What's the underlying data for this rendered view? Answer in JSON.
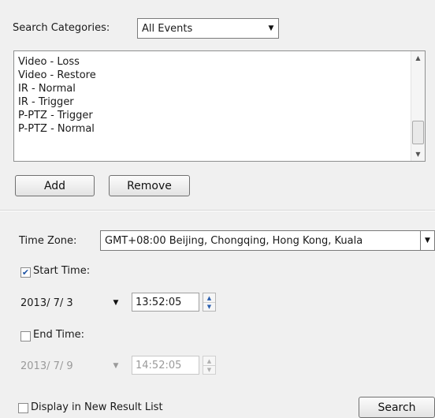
{
  "search_categories": {
    "label": "Search Categories:",
    "selected": "All Events",
    "options_visible": [
      "All Events"
    ]
  },
  "event_list": {
    "items": [
      "Video - Loss",
      "Video - Restore",
      "IR - Normal",
      "IR - Trigger",
      "P-PTZ - Trigger",
      "P-PTZ - Normal"
    ]
  },
  "buttons": {
    "add": "Add",
    "remove": "Remove",
    "search": "Search"
  },
  "time_zone": {
    "label": "Time Zone:",
    "value": "GMT+08:00 Beijing, Chongqing, Hong Kong, Kuala"
  },
  "start_time": {
    "label": "Start Time:",
    "checked": true,
    "date": "2013/ 7/ 3",
    "time": "13:52:05"
  },
  "end_time": {
    "label": "End Time:",
    "checked": false,
    "date": "2013/ 7/ 9",
    "time": "14:52:05"
  },
  "display_new_list": {
    "label": "Display in New Result List",
    "checked": false
  }
}
